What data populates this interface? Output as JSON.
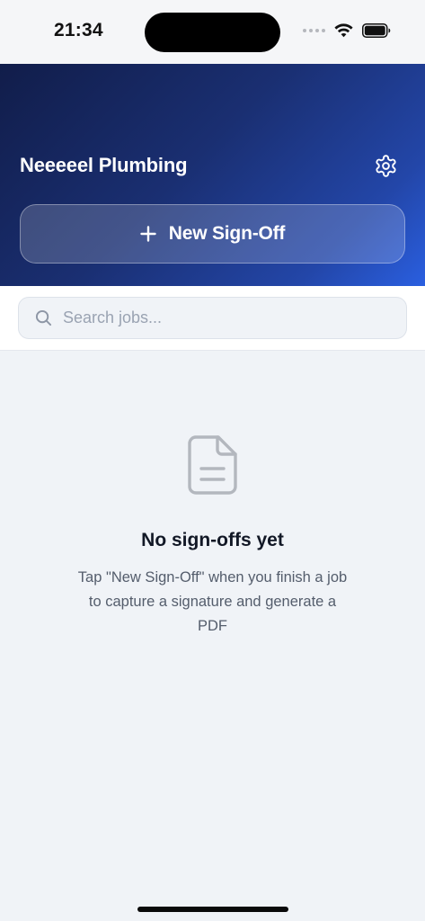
{
  "status_bar": {
    "time": "21:34"
  },
  "header": {
    "brand_name": "Neeeeel Plumbing",
    "new_signoff_label": "New Sign-Off",
    "gradient_start": "#111d4a",
    "gradient_end": "#2a5fe0"
  },
  "search": {
    "placeholder": "Search jobs...",
    "value": ""
  },
  "empty_state": {
    "title": "No sign-offs yet",
    "description": "Tap \"New Sign-Off\" when you finish a job to capture a signature and generate a PDF"
  },
  "icons": {
    "settings": "gear-icon",
    "add": "plus-icon",
    "search": "search-icon",
    "document": "document-icon",
    "wifi": "wifi-icon",
    "battery": "battery-icon"
  }
}
